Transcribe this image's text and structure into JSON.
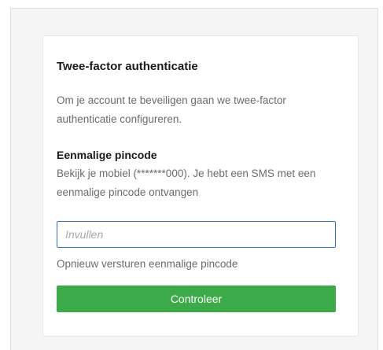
{
  "card": {
    "title": "Twee-factor authenticatie",
    "intro": "Om je account te beveiligen gaan we twee-factor authenticatie configureren.",
    "subheading": "Eenmalige pincode",
    "description": "Bekijk je mobiel (*******000). Je hebt een SMS met een eenmalige pincode ontvangen"
  },
  "form": {
    "pin_value": "",
    "pin_placeholder": "Invullen",
    "resend_label": "Opnieuw versturen eenmalige pincode",
    "submit_label": "Controleer"
  },
  "colors": {
    "accent_button": "#3daa4a",
    "input_focus_border": "#2e6fb8",
    "panel_background": "#f5f5f5"
  }
}
